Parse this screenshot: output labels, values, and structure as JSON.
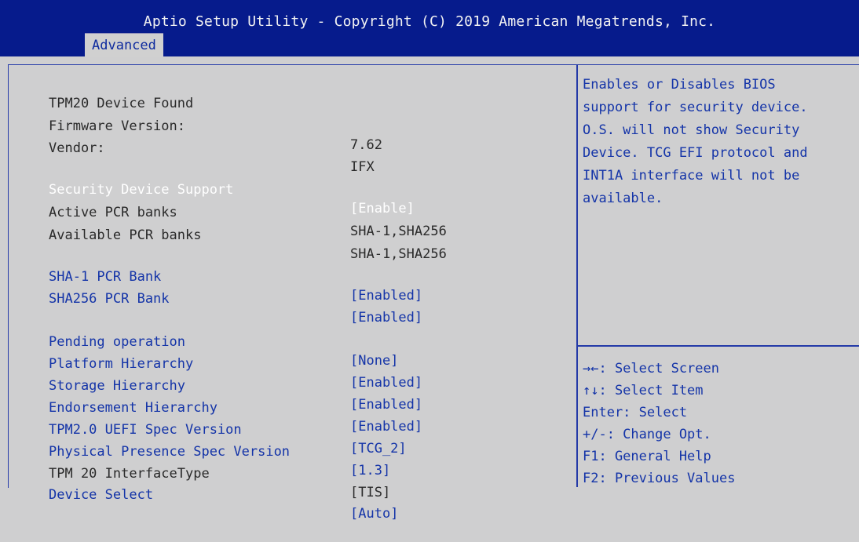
{
  "header": {
    "title": "Aptio Setup Utility - Copyright (C) 2019 American Megatrends, Inc.",
    "active_tab": "Advanced"
  },
  "settings": [
    {
      "label": "TPM20 Device Found",
      "value": "",
      "kind": "static"
    },
    {
      "label": "Firmware Version:",
      "value": "7.62",
      "kind": "static"
    },
    {
      "label": "Vendor:",
      "value": "IFX",
      "kind": "static"
    },
    {
      "label": "Security Device Support",
      "value": "[Enable]",
      "kind": "selected"
    },
    {
      "label": "Active PCR banks",
      "value": "SHA-1,SHA256",
      "kind": "static"
    },
    {
      "label": "Available PCR banks",
      "value": "SHA-1,SHA256",
      "kind": "static"
    },
    {
      "label": "SHA-1 PCR Bank",
      "value": "[Enabled]",
      "kind": "option"
    },
    {
      "label": "SHA256 PCR Bank",
      "value": "[Enabled]",
      "kind": "option"
    },
    {
      "label": "Pending operation",
      "value": "[None]",
      "kind": "option"
    },
    {
      "label": "Platform Hierarchy",
      "value": "[Enabled]",
      "kind": "option"
    },
    {
      "label": "Storage Hierarchy",
      "value": "[Enabled]",
      "kind": "option"
    },
    {
      "label": "Endorsement Hierarchy",
      "value": "[Enabled]",
      "kind": "option"
    },
    {
      "label": "TPM2.0 UEFI Spec Version",
      "value": "[TCG_2]",
      "kind": "option"
    },
    {
      "label": "Physical Presence Spec Version",
      "value": "[1.3]",
      "kind": "option"
    },
    {
      "label": "TPM 20 InterfaceType",
      "value": "[TIS]",
      "kind": "static"
    },
    {
      "label": "Device Select",
      "value": "[Auto]",
      "kind": "option"
    }
  ],
  "help_text": [
    "Enables or Disables BIOS",
    "support for security device.",
    "O.S. will not show Security",
    "Device. TCG EFI protocol and",
    "INT1A interface will not be",
    "available."
  ],
  "key_hints": [
    "→←: Select Screen",
    "↑↓: Select Item",
    "Enter: Select",
    "+/-: Change Opt.",
    "F1: General Help",
    "F2: Previous Values"
  ],
  "colors": {
    "header_bg": "#061b8c",
    "body_bg": "#cfcfd0",
    "option_text": "#1434a8",
    "static_text": "#2a2a2a",
    "selected_text": "#ffffff"
  }
}
